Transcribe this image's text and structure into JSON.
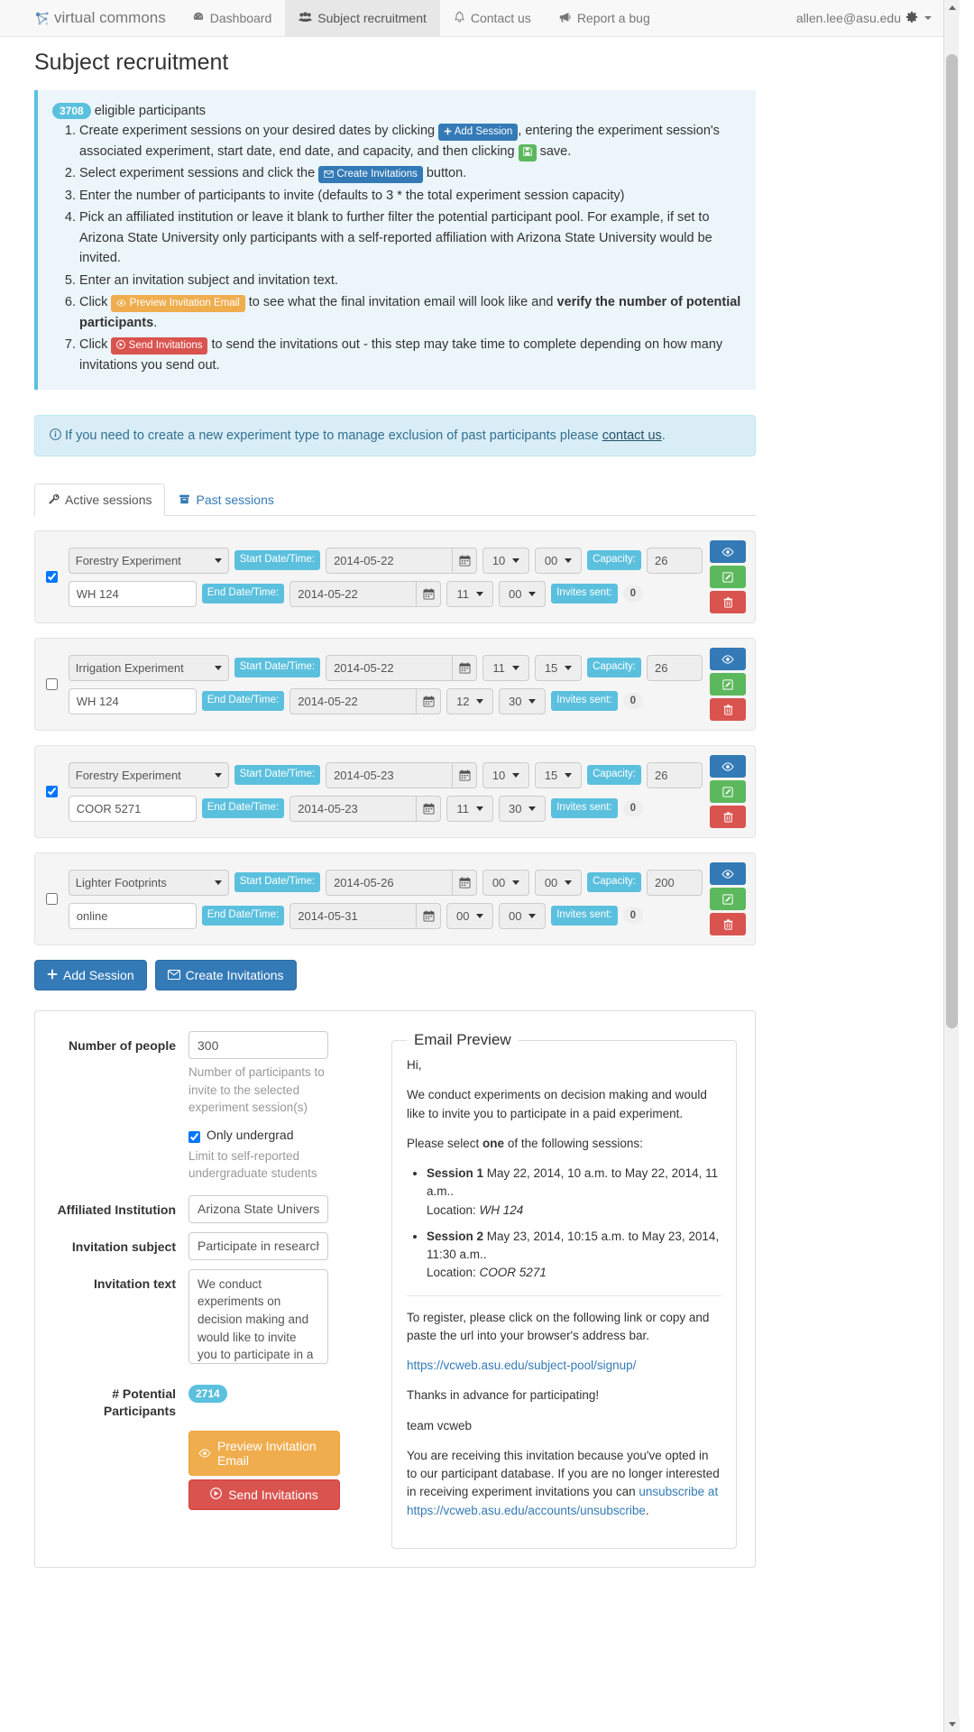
{
  "navbar": {
    "brand": "virtual commons",
    "brand_icon": "network-nodes-icon",
    "items": [
      {
        "label": "Dashboard",
        "icon": "dashboard-icon",
        "active": false
      },
      {
        "label": "Subject recruitment",
        "icon": "users-icon",
        "active": true
      },
      {
        "label": "Contact us",
        "icon": "bell-icon",
        "active": false
      },
      {
        "label": "Report a bug",
        "icon": "bullhorn-icon",
        "active": false
      }
    ],
    "user": "allen.lee@asu.edu",
    "user_icon": "gear-icon"
  },
  "page_title": "Subject recruitment",
  "instructions": {
    "eligible_count": "3708",
    "eligible_label": "eligible participants",
    "steps": [
      {
        "parts": [
          {
            "t": "text",
            "v": "Create experiment sessions on your desired dates by clicking "
          },
          {
            "t": "btn-blue",
            "v": "Add Session",
            "icon": "plus-icon"
          },
          {
            "t": "text",
            "v": ", entering the experiment session's associated experiment, start date, end date, and capacity, and then clicking "
          },
          {
            "t": "btn-green",
            "v": "",
            "icon": "save-icon"
          },
          {
            "t": "text",
            "v": " save."
          }
        ]
      },
      {
        "parts": [
          {
            "t": "text",
            "v": "Select experiment sessions and click the "
          },
          {
            "t": "btn-blue",
            "v": "Create Invitations",
            "icon": "envelope-icon"
          },
          {
            "t": "text",
            "v": " button."
          }
        ]
      },
      {
        "parts": [
          {
            "t": "text",
            "v": "Enter the number of participants to invite (defaults to 3 * the total experiment session capacity)"
          }
        ]
      },
      {
        "parts": [
          {
            "t": "text",
            "v": "Pick an affiliated institution or leave it blank to further filter the potential participant pool. For example, if set to Arizona State University only participants with a self-reported affiliation with Arizona State University would be invited."
          }
        ]
      },
      {
        "parts": [
          {
            "t": "text",
            "v": "Enter an invitation subject and invitation text."
          }
        ]
      },
      {
        "parts": [
          {
            "t": "text",
            "v": "Click "
          },
          {
            "t": "btn-orange",
            "v": "Preview Invitation Email",
            "icon": "eye-icon"
          },
          {
            "t": "text",
            "v": " to see what the final invitation email will look like and "
          },
          {
            "t": "bold",
            "v": "verify the number of potential participants"
          },
          {
            "t": "text",
            "v": "."
          }
        ]
      },
      {
        "parts": [
          {
            "t": "text",
            "v": "Click "
          },
          {
            "t": "btn-red",
            "v": "Send Invitations",
            "icon": "send-icon"
          },
          {
            "t": "text",
            "v": " to send the invitations out - this step may take time to complete depending on how many invitations you send out."
          }
        ]
      }
    ]
  },
  "contact_alert": {
    "icon": "info-circle-icon",
    "text_before": "If you need to create a new experiment type to manage exclusion of past participants please ",
    "link": "contact us",
    "text_after": "."
  },
  "tabs": [
    {
      "label": "Active sessions",
      "icon": "wrench-icon",
      "active": true
    },
    {
      "label": "Past sessions",
      "icon": "archive-icon",
      "active": false
    }
  ],
  "session_labels": {
    "start": "Start Date/Time:",
    "end": "End Date/Time:",
    "capacity": "Capacity:",
    "invites_sent": "Invites sent:"
  },
  "sessions": [
    {
      "selected": true,
      "experiment": "Forestry Experiment",
      "location": "WH 124",
      "start_date": "2014-05-22",
      "start_hh": "10",
      "start_mm": "00",
      "end_date": "2014-05-22",
      "end_hh": "11",
      "end_mm": "00",
      "capacity": "26",
      "invites_sent": "0"
    },
    {
      "selected": false,
      "experiment": "Irrigation Experiment",
      "location": "WH 124",
      "start_date": "2014-05-22",
      "start_hh": "11",
      "start_mm": "15",
      "end_date": "2014-05-22",
      "end_hh": "12",
      "end_mm": "30",
      "capacity": "26",
      "invites_sent": "0"
    },
    {
      "selected": true,
      "experiment": "Forestry Experiment",
      "location": "COOR 5271",
      "start_date": "2014-05-23",
      "start_hh": "10",
      "start_mm": "15",
      "end_date": "2014-05-23",
      "end_hh": "11",
      "end_mm": "30",
      "capacity": "26",
      "invites_sent": "0"
    },
    {
      "selected": false,
      "experiment": "Lighter Footprints",
      "location": "online",
      "start_date": "2014-05-26",
      "start_hh": "00",
      "start_mm": "00",
      "end_date": "2014-05-31",
      "end_hh": "00",
      "end_mm": "00",
      "capacity": "200",
      "invites_sent": "0"
    }
  ],
  "main_buttons": {
    "add_session": "Add Session",
    "create_invitations": "Create Invitations"
  },
  "form": {
    "number_of_people_label": "Number of people",
    "number_of_people_value": "300",
    "number_of_people_help": "Number of participants to invite to the selected experiment session(s)",
    "only_undergrad_label": "Only undergrad",
    "only_undergrad_checked": true,
    "only_undergrad_help": "Limit to self-reported undergraduate students",
    "affiliated_institution_label": "Affiliated Institution",
    "affiliated_institution_value": "Arizona State University",
    "invitation_subject_label": "Invitation subject",
    "invitation_subject_value": "Participate in research",
    "invitation_text_label": "Invitation text",
    "invitation_text_value": "We conduct experiments on decision making and would like to invite you to participate in a paid experiment.",
    "potential_participants_label": "# Potential Participants",
    "potential_participants_count": "2714",
    "preview_button": "Preview Invitation Email",
    "send_button": "Send Invitations"
  },
  "email_preview": {
    "legend": "Email Preview",
    "greeting": "Hi,",
    "intro": "We conduct experiments on decision making and would like to invite you to participate in a paid experiment.",
    "select_before": "Please select ",
    "select_bold": "one",
    "select_after": " of the following sessions:",
    "sessions": [
      {
        "name": "Session 1",
        "time": " May 22, 2014, 10 a.m. to May 22, 2014, 11 a.m..",
        "location_label": "Location: ",
        "location": "WH 124"
      },
      {
        "name": "Session 2",
        "time": " May 23, 2014, 10:15 a.m. to May 23, 2014, 11:30 a.m..",
        "location_label": "Location: ",
        "location": "COOR 5271"
      }
    ],
    "register_text": "To register, please click on the following link or copy and paste the url into your browser's address bar.",
    "signup_link": "https://vcweb.asu.edu/subject-pool/signup/",
    "thanks": "Thanks in advance for participating!",
    "team": "team vcweb",
    "footer_before": "You are receiving this invitation because you've opted in to our participant database. If you are no longer interested in receiving experiment invitations you can ",
    "footer_link1": "unsubscribe at https://vcweb.asu.edu/accounts/unsubscribe",
    "footer_after": "."
  },
  "colors": {
    "primary": "#337ab7",
    "info": "#5bc0de",
    "success": "#5cb85c",
    "warning": "#f0ad4e",
    "danger": "#d9534f"
  }
}
